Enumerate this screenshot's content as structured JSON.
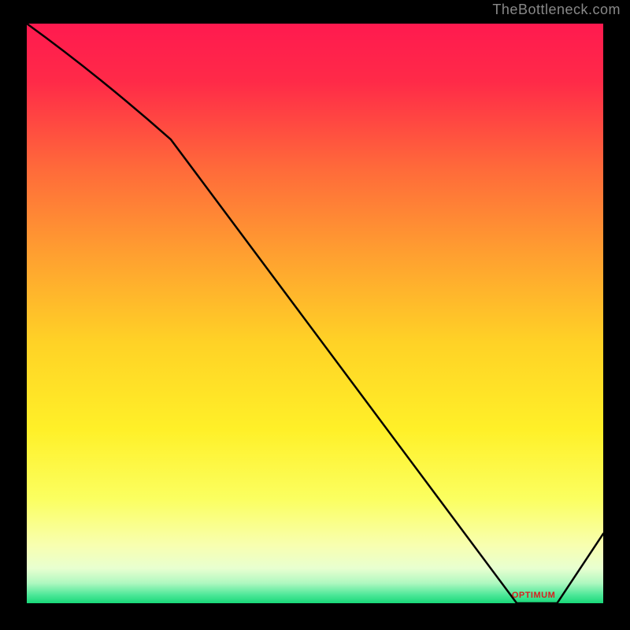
{
  "attribution": "TheBottleneck.com",
  "bottom_label": "OPTIMUM",
  "chart_data": {
    "type": "line",
    "title": "",
    "xlabel": "",
    "ylabel": "",
    "xlim": [
      0,
      100
    ],
    "ylim": [
      0,
      100
    ],
    "x": [
      0,
      25,
      85,
      92,
      100
    ],
    "values": [
      100,
      80,
      0,
      0,
      12
    ],
    "series": [
      {
        "name": "bottleneck-curve",
        "x": [
          0,
          25,
          85,
          92,
          100
        ],
        "values": [
          100,
          80,
          0,
          0,
          12
        ]
      }
    ],
    "gradient_stops": [
      {
        "pos": 0.0,
        "color": "#ff1a4f"
      },
      {
        "pos": 0.1,
        "color": "#ff2a48"
      },
      {
        "pos": 0.25,
        "color": "#ff6a3a"
      },
      {
        "pos": 0.4,
        "color": "#ffa030"
      },
      {
        "pos": 0.55,
        "color": "#ffd226"
      },
      {
        "pos": 0.7,
        "color": "#fff028"
      },
      {
        "pos": 0.82,
        "color": "#fbff60"
      },
      {
        "pos": 0.9,
        "color": "#f8ffb0"
      },
      {
        "pos": 0.94,
        "color": "#e8ffd0"
      },
      {
        "pos": 0.965,
        "color": "#b0f8c0"
      },
      {
        "pos": 0.985,
        "color": "#50e89a"
      },
      {
        "pos": 1.0,
        "color": "#18d878"
      }
    ],
    "optimum_band": {
      "start": 83,
      "end": 94
    }
  }
}
